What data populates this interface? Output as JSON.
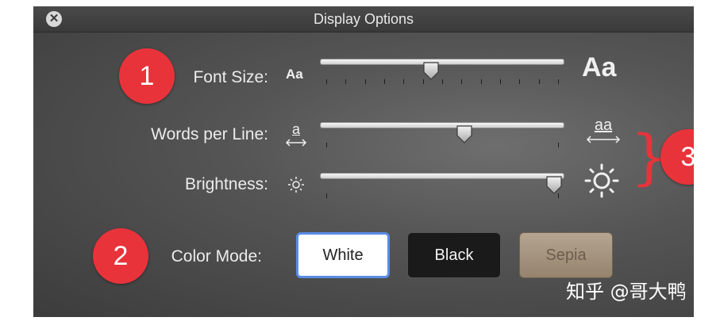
{
  "window": {
    "title": "Display Options",
    "close_symbol": "✕"
  },
  "badges": [
    "1",
    "2",
    "3"
  ],
  "font_size": {
    "label": "Font Size:",
    "small_icon_text": "Aa",
    "large_icon_text": "Aa",
    "level": 0.45,
    "tick_count": 13
  },
  "words_per_line": {
    "label": "Words per Line:",
    "small_icon_text": "a",
    "large_icon_text": "aa",
    "level": 0.6,
    "tick_count": 2
  },
  "brightness": {
    "label": "Brightness:",
    "small_icon_name": "sun-small-icon",
    "large_icon_name": "sun-large-icon",
    "level": 1.0,
    "tick_count": 2
  },
  "color_mode": {
    "label": "Color Mode:",
    "options": [
      "White",
      "Black",
      "Sepia"
    ],
    "selected": "White"
  },
  "watermark": "知乎 @哥大鸭",
  "colors": {
    "badge": "#e8333b",
    "selected_border": "#5a8de6",
    "panel": "#555555"
  }
}
